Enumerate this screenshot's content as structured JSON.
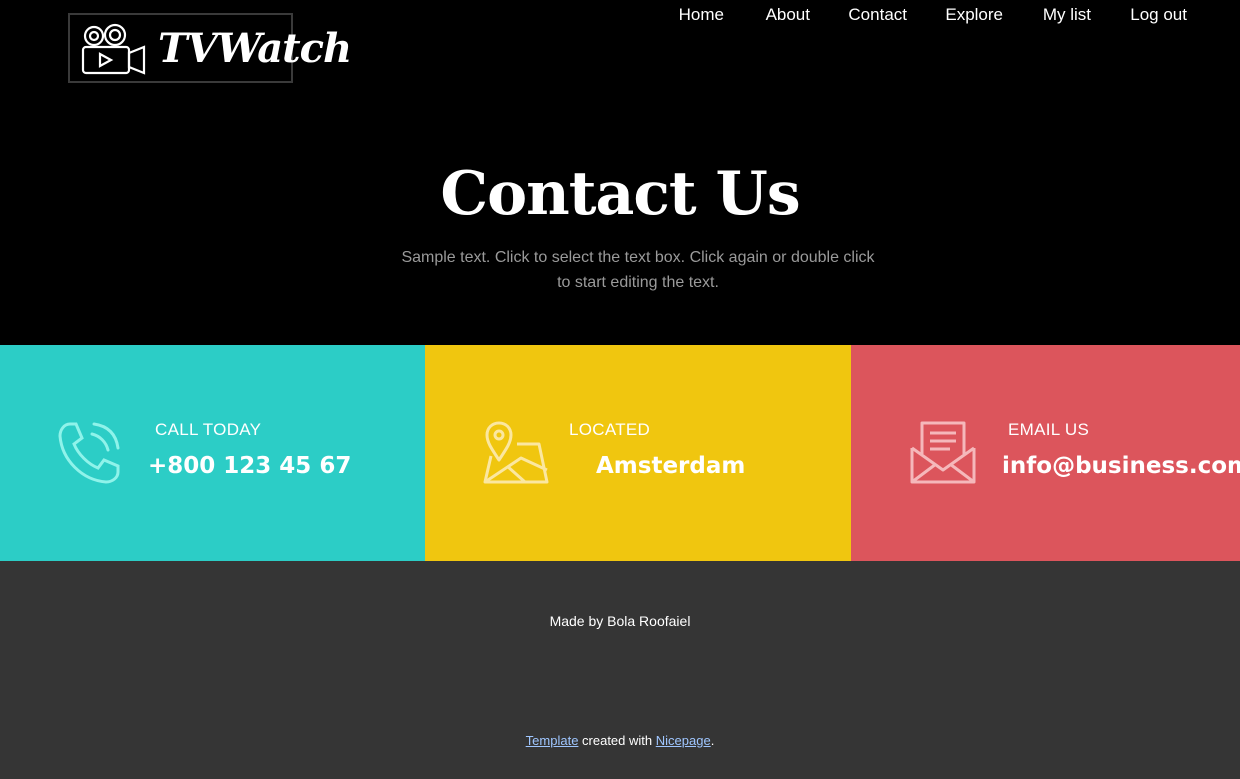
{
  "header": {
    "logo_text": "TVWatch",
    "logo_icon": "video-camera-icon",
    "nav": [
      "Home",
      "About",
      "Contact",
      "Explore",
      "My list",
      "Log out"
    ]
  },
  "hero": {
    "title": "Contact Us",
    "subtitle": "Sample text. Click to select the text box. Click again or double click to start editing the text."
  },
  "contact": [
    {
      "label": "CALL TODAY",
      "value": "+800 123 45 67",
      "icon": "phone-icon",
      "color": "#2ccdc6"
    },
    {
      "label": "LOCATED",
      "value": "Amsterdam",
      "icon": "map-pin-icon",
      "color": "#f0c60f"
    },
    {
      "label": "EMAIL US",
      "value": "info@business.com",
      "icon": "envelope-icon",
      "color": "#dc555c"
    }
  ],
  "footer": {
    "made_by": "Made by Bola Roofaiel",
    "credit_link1": "Template",
    "credit_middle": " created with ",
    "credit_link2": "Nicepage",
    "credit_end": "."
  }
}
